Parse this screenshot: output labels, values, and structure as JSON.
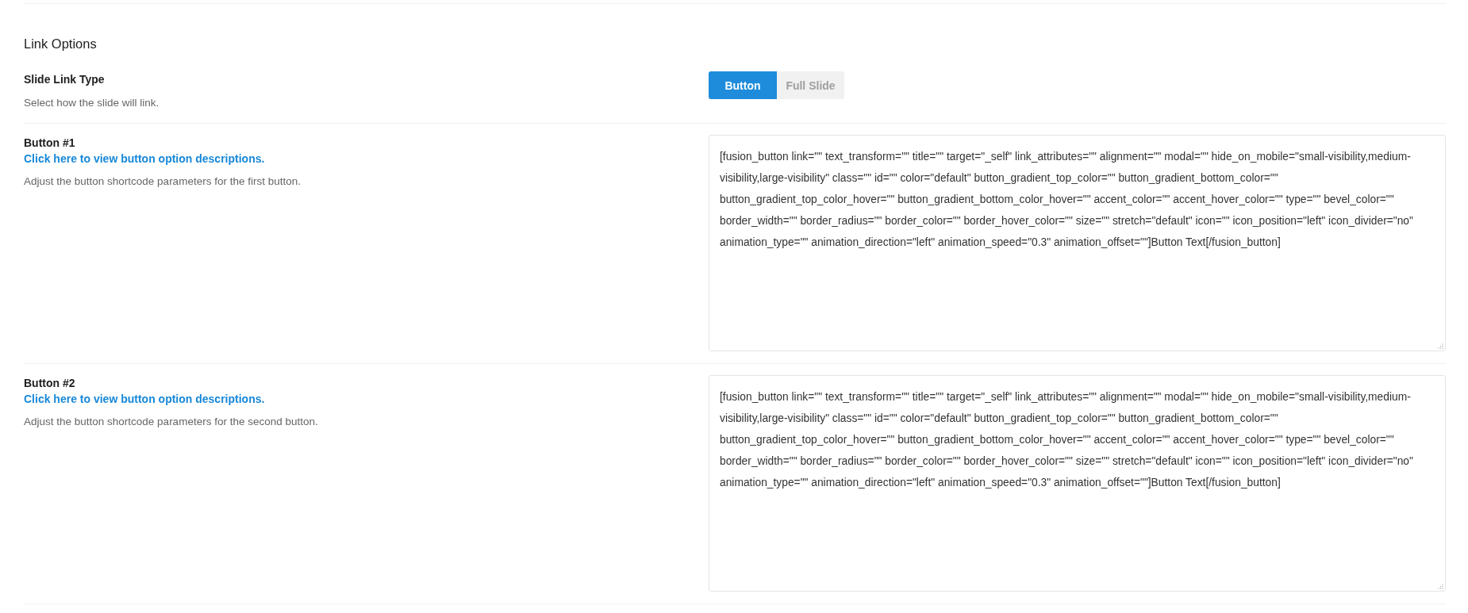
{
  "section": {
    "title": "Link Options"
  },
  "options": [
    {
      "kind": "toggle",
      "label": "Slide Link Type",
      "description": "Select how the slide will link.",
      "choices": [
        {
          "label": "Button",
          "selected": true
        },
        {
          "label": "Full Slide",
          "selected": false
        }
      ]
    },
    {
      "kind": "textarea",
      "label": "Button #1",
      "link": "Click here to view button option descriptions.",
      "description": "Adjust the button shortcode parameters for the first button.",
      "value": "[fusion_button link=\"\" text_transform=\"\" title=\"\" target=\"_self\" link_attributes=\"\" alignment=\"\" modal=\"\" hide_on_mobile=\"small-visibility,medium-visibility,large-visibility\" class=\"\" id=\"\" color=\"default\" button_gradient_top_color=\"\" button_gradient_bottom_color=\"\" button_gradient_top_color_hover=\"\" button_gradient_bottom_color_hover=\"\" accent_color=\"\" accent_hover_color=\"\" type=\"\" bevel_color=\"\" border_width=\"\" border_radius=\"\" border_color=\"\" border_hover_color=\"\" size=\"\" stretch=\"default\" icon=\"\" icon_position=\"left\" icon_divider=\"no\" animation_type=\"\" animation_direction=\"left\" animation_speed=\"0.3\" animation_offset=\"\"]Button Text[/fusion_button]"
    },
    {
      "kind": "textarea",
      "label": "Button #2",
      "link": "Click here to view button option descriptions.",
      "description": "Adjust the button shortcode parameters for the second button.",
      "value": "[fusion_button link=\"\" text_transform=\"\" title=\"\" target=\"_self\" link_attributes=\"\" alignment=\"\" modal=\"\" hide_on_mobile=\"small-visibility,medium-visibility,large-visibility\" class=\"\" id=\"\" color=\"default\" button_gradient_top_color=\"\" button_gradient_bottom_color=\"\" button_gradient_top_color_hover=\"\" button_gradient_bottom_color_hover=\"\" accent_color=\"\" accent_hover_color=\"\" type=\"\" bevel_color=\"\" border_width=\"\" border_radius=\"\" border_color=\"\" border_hover_color=\"\" size=\"\" stretch=\"default\" icon=\"\" icon_position=\"left\" icon_divider=\"no\" animation_type=\"\" animation_direction=\"left\" animation_speed=\"0.3\" animation_offset=\"\"]Button Text[/fusion_button]"
    }
  ]
}
